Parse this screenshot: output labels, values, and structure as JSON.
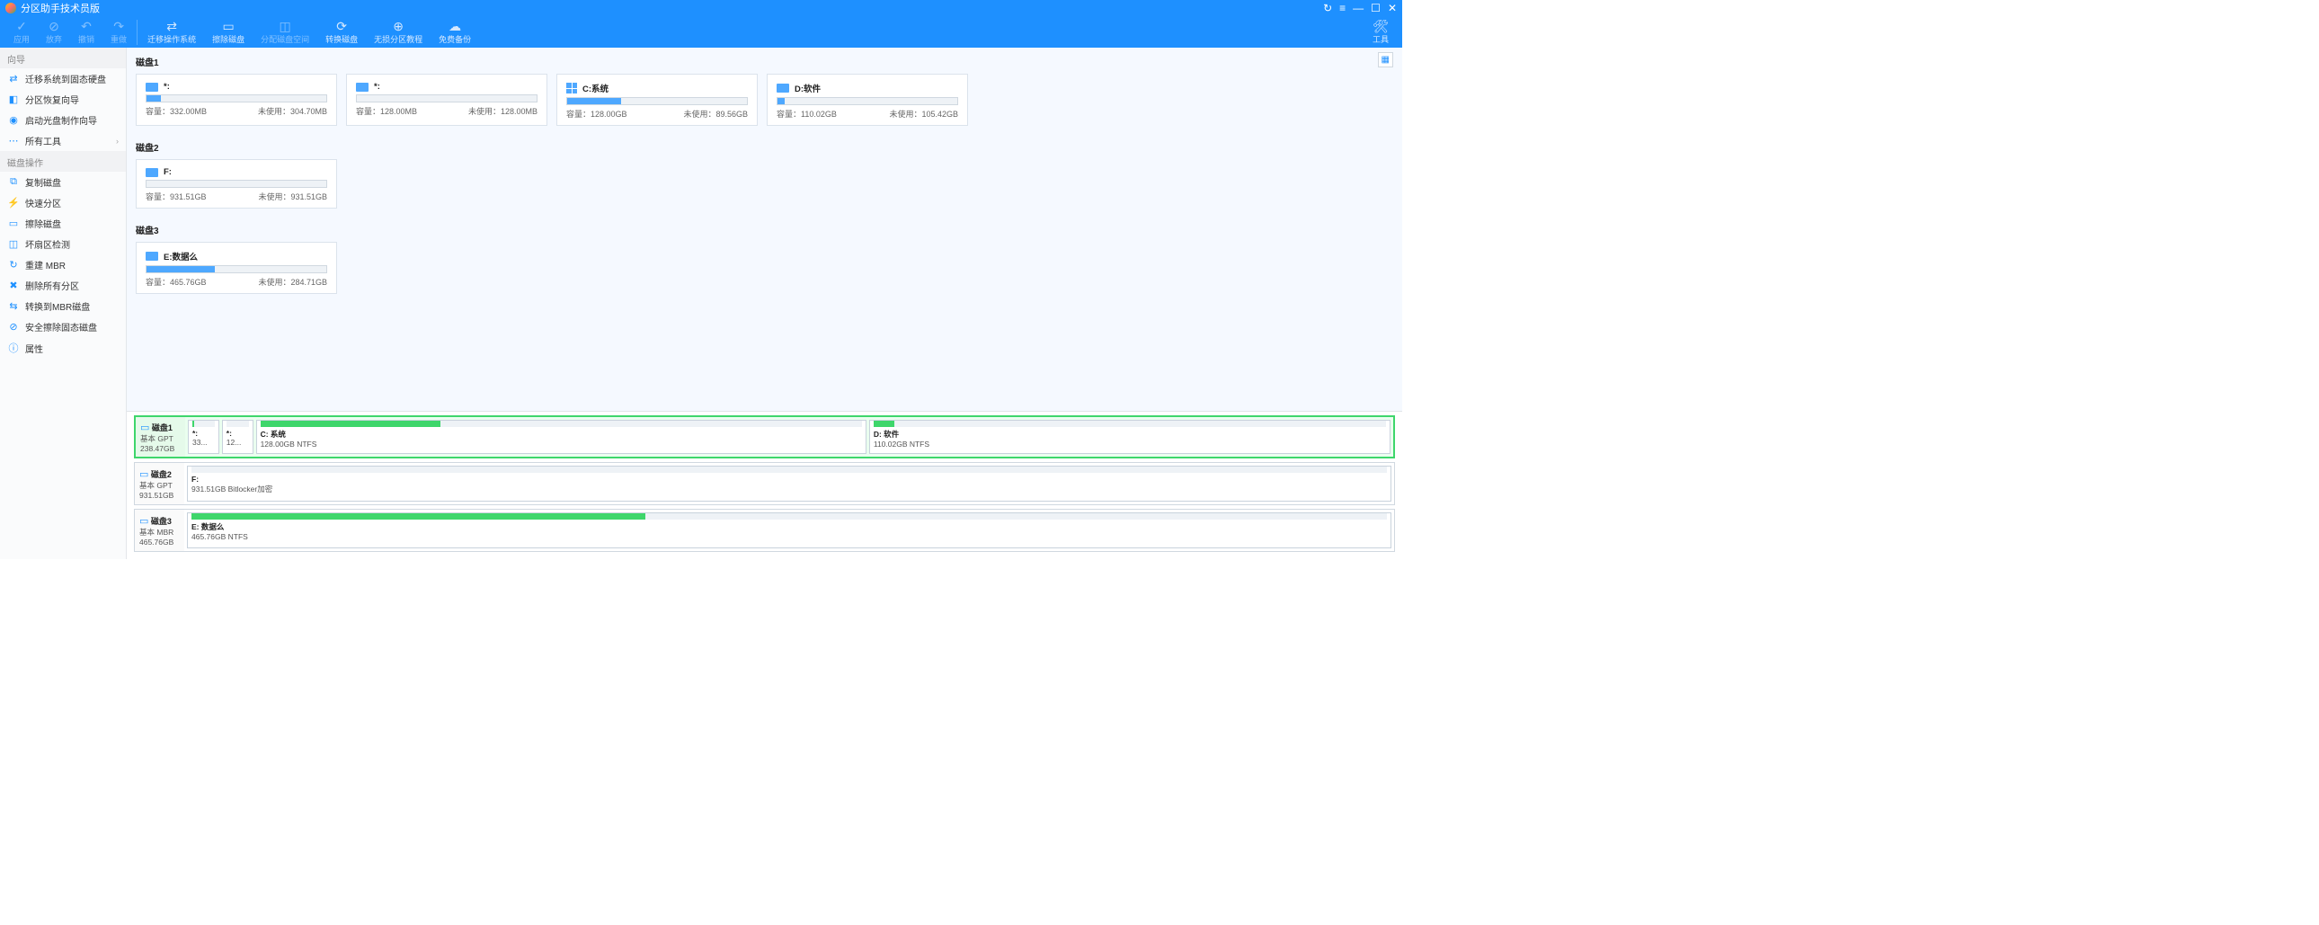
{
  "app_title": "分区助手技术员版",
  "window_controls": {
    "refresh": "↻",
    "menu": "≡",
    "min": "—",
    "max": "☐",
    "close": "✕"
  },
  "toolbar": [
    {
      "label": "应用",
      "icon": "✓",
      "disabled": true
    },
    {
      "label": "放弃",
      "icon": "⊘",
      "disabled": true
    },
    {
      "label": "撤销",
      "icon": "↶",
      "disabled": true
    },
    {
      "label": "重做",
      "icon": "↷",
      "disabled": true
    },
    {
      "sep": true
    },
    {
      "label": "迁移操作系统",
      "icon": "⇄",
      "disabled": false
    },
    {
      "label": "擦除磁盘",
      "icon": "▭",
      "disabled": false
    },
    {
      "label": "分配磁盘空间",
      "icon": "◫",
      "disabled": true
    },
    {
      "label": "转换磁盘",
      "icon": "⟳",
      "disabled": false
    },
    {
      "label": "无损分区教程",
      "icon": "⊕",
      "disabled": false
    },
    {
      "label": "免费备份",
      "icon": "☁",
      "disabled": false
    }
  ],
  "toolbar_right": {
    "label": "工具",
    "icon": "🛠"
  },
  "sidebar": {
    "sections": [
      {
        "title": "向导",
        "items": [
          {
            "icon": "⇄",
            "label": "迁移系统到固态硬盘"
          },
          {
            "icon": "◧",
            "label": "分区恢复向导"
          },
          {
            "icon": "◉",
            "label": "启动光盘制作向导"
          },
          {
            "icon": "⋯",
            "label": "所有工具",
            "chev": "›"
          }
        ]
      },
      {
        "title": "磁盘操作",
        "items": [
          {
            "icon": "⧉",
            "label": "复制磁盘"
          },
          {
            "icon": "⚡",
            "label": "快速分区"
          },
          {
            "icon": "▭",
            "label": "擦除磁盘"
          },
          {
            "icon": "◫",
            "label": "坏扇区检测"
          },
          {
            "icon": "↻",
            "label": "重建 MBR"
          },
          {
            "icon": "✖",
            "label": "删除所有分区"
          },
          {
            "icon": "⇆",
            "label": "转换到MBR磁盘"
          },
          {
            "icon": "⊘",
            "label": "安全擦除固态磁盘"
          },
          {
            "icon": "ⓘ",
            "label": "属性"
          }
        ]
      }
    ]
  },
  "upper_disks": [
    {
      "title": "磁盘1",
      "partitions": [
        {
          "drive": "*:",
          "cap_label": "容量：",
          "cap": "332.00MB",
          "free_label": "未使用：",
          "free": "304.70MB",
          "fill": 8
        },
        {
          "drive": "*:",
          "cap_label": "容量：",
          "cap": "128.00MB",
          "free_label": "未使用：",
          "free": "128.00MB",
          "fill": 0
        },
        {
          "drive": "C:系统",
          "win": true,
          "cap_label": "容量：",
          "cap": "128.00GB",
          "free_label": "未使用：",
          "free": "89.56GB",
          "fill": 30
        },
        {
          "drive": "D:软件",
          "cap_label": "容量：",
          "cap": "110.02GB",
          "free_label": "未使用：",
          "free": "105.42GB",
          "fill": 4
        }
      ]
    },
    {
      "title": "磁盘2",
      "partitions": [
        {
          "drive": "F:",
          "cap_label": "容量：",
          "cap": "931.51GB",
          "free_label": "未使用：",
          "free": "931.51GB",
          "fill": 0
        }
      ]
    },
    {
      "title": "磁盘3",
      "partitions": [
        {
          "drive": "E:数据么",
          "cap_label": "容量：",
          "cap": "465.76GB",
          "free_label": "未使用：",
          "free": "284.71GB",
          "fill": 38
        }
      ]
    }
  ],
  "lower_disks": [
    {
      "name": "磁盘1",
      "type": "基本 GPT",
      "size": "238.47GB",
      "selected": true,
      "parts": [
        {
          "label": "*:",
          "sub": "33...",
          "fill": 8,
          "flex": 2
        },
        {
          "label": "*:",
          "sub": "12...",
          "fill": 0,
          "flex": 2
        },
        {
          "label": "C: 系统",
          "sub": "128.00GB NTFS",
          "fill": 30,
          "flex": 54
        },
        {
          "label": "D: 软件",
          "sub": "110.02GB NTFS",
          "fill": 4,
          "flex": 46
        }
      ]
    },
    {
      "name": "磁盘2",
      "type": "基本 GPT",
      "size": "931.51GB",
      "selected": false,
      "parts": [
        {
          "label": "F:",
          "sub": "931.51GB Bitlocker加密",
          "fill": 0,
          "flex": 100
        }
      ]
    },
    {
      "name": "磁盘3",
      "type": "基本 MBR",
      "size": "465.76GB",
      "selected": false,
      "parts": [
        {
          "label": "E: 数据么",
          "sub": "465.76GB NTFS",
          "fill": 38,
          "flex": 100
        }
      ]
    }
  ],
  "view_toggle": "▦"
}
